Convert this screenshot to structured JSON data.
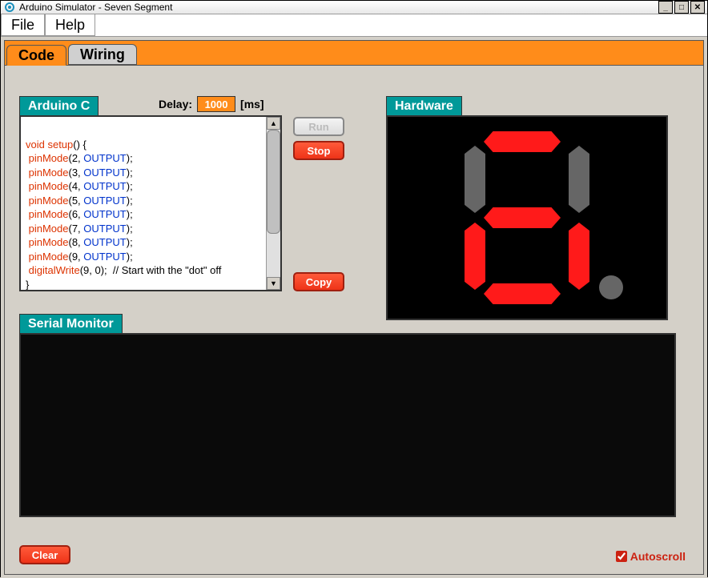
{
  "window": {
    "title": "Arduino Simulator - Seven Segment"
  },
  "menu": {
    "file": "File",
    "help": "Help"
  },
  "tabs": {
    "code": "Code",
    "wiring": "Wiring",
    "active": "code"
  },
  "headers": {
    "arduino": "Arduino C",
    "hardware": "Hardware",
    "serial": "Serial Monitor"
  },
  "delay": {
    "label": "Delay:",
    "value": "1000",
    "unit": "[ms]"
  },
  "buttons": {
    "run": "Run",
    "stop": "Stop",
    "copy": "Copy",
    "clear": "Clear"
  },
  "autoscroll": {
    "label": "Autoscroll",
    "checked": true
  },
  "code_lines": [
    {
      "tokens": [
        {
          "t": "",
          "c": ""
        }
      ]
    },
    {
      "tokens": [
        {
          "t": "void setup",
          "c": "kw-red"
        },
        {
          "t": "() {",
          "c": ""
        }
      ]
    },
    {
      "tokens": [
        {
          "t": " ",
          "c": ""
        },
        {
          "t": "pinMode",
          "c": "kw-red"
        },
        {
          "t": "(2, ",
          "c": ""
        },
        {
          "t": "OUTPUT",
          "c": "kw-blue"
        },
        {
          "t": ");",
          "c": ""
        }
      ]
    },
    {
      "tokens": [
        {
          "t": " ",
          "c": ""
        },
        {
          "t": "pinMode",
          "c": "kw-red"
        },
        {
          "t": "(3, ",
          "c": ""
        },
        {
          "t": "OUTPUT",
          "c": "kw-blue"
        },
        {
          "t": ");",
          "c": ""
        }
      ]
    },
    {
      "tokens": [
        {
          "t": " ",
          "c": ""
        },
        {
          "t": "pinMode",
          "c": "kw-red"
        },
        {
          "t": "(4, ",
          "c": ""
        },
        {
          "t": "OUTPUT",
          "c": "kw-blue"
        },
        {
          "t": ");",
          "c": ""
        }
      ]
    },
    {
      "tokens": [
        {
          "t": " ",
          "c": ""
        },
        {
          "t": "pinMode",
          "c": "kw-red"
        },
        {
          "t": "(5, ",
          "c": ""
        },
        {
          "t": "OUTPUT",
          "c": "kw-blue"
        },
        {
          "t": ");",
          "c": ""
        }
      ]
    },
    {
      "tokens": [
        {
          "t": " ",
          "c": ""
        },
        {
          "t": "pinMode",
          "c": "kw-red"
        },
        {
          "t": "(6, ",
          "c": ""
        },
        {
          "t": "OUTPUT",
          "c": "kw-blue"
        },
        {
          "t": ");",
          "c": ""
        }
      ]
    },
    {
      "tokens": [
        {
          "t": " ",
          "c": ""
        },
        {
          "t": "pinMode",
          "c": "kw-red"
        },
        {
          "t": "(7, ",
          "c": ""
        },
        {
          "t": "OUTPUT",
          "c": "kw-blue"
        },
        {
          "t": ");",
          "c": ""
        }
      ]
    },
    {
      "tokens": [
        {
          "t": " ",
          "c": ""
        },
        {
          "t": "pinMode",
          "c": "kw-red"
        },
        {
          "t": "(8, ",
          "c": ""
        },
        {
          "t": "OUTPUT",
          "c": "kw-blue"
        },
        {
          "t": ");",
          "c": ""
        }
      ]
    },
    {
      "tokens": [
        {
          "t": " ",
          "c": ""
        },
        {
          "t": "pinMode",
          "c": "kw-red"
        },
        {
          "t": "(9, ",
          "c": ""
        },
        {
          "t": "OUTPUT",
          "c": "kw-blue"
        },
        {
          "t": ");",
          "c": ""
        }
      ]
    },
    {
      "tokens": [
        {
          "t": " ",
          "c": ""
        },
        {
          "t": "digitalWrite",
          "c": "kw-red"
        },
        {
          "t": "(9, 0);  // Start with the \"dot\" off",
          "c": ""
        }
      ]
    },
    {
      "tokens": [
        {
          "t": "}",
          "c": ""
        }
      ]
    }
  ],
  "segments": {
    "a": true,
    "b": false,
    "c": true,
    "d": true,
    "e": true,
    "f": false,
    "g": true,
    "dp": false
  }
}
